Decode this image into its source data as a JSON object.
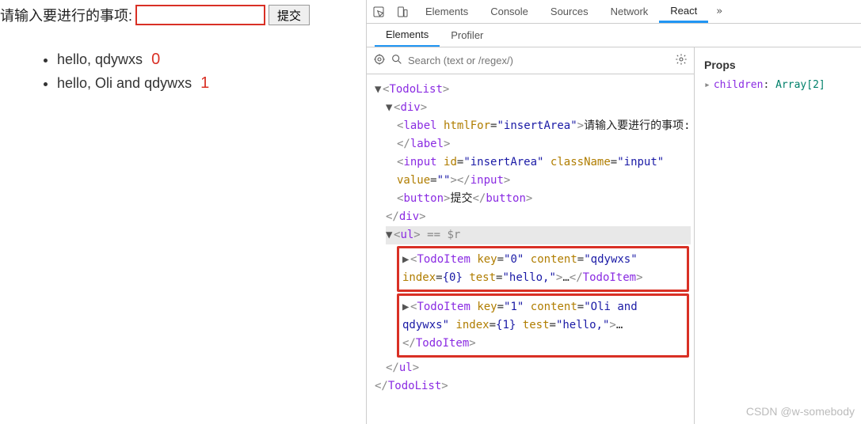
{
  "app": {
    "label": "请输入要进行的事项:",
    "inputValue": "",
    "submitLabel": "提交",
    "items": [
      {
        "text": "hello, qdywxs",
        "index": "0"
      },
      {
        "text": "hello, Oli and qdywxs",
        "index": "1"
      }
    ]
  },
  "devtools": {
    "tabs": [
      "Elements",
      "Console",
      "Sources",
      "Network",
      "React"
    ],
    "activeTab": "React",
    "more": "»",
    "subtabs": [
      "Elements",
      "Profiler"
    ],
    "activeSubtab": "Elements",
    "searchPlaceholder": "Search (text or /regex/)",
    "tree": {
      "root": "TodoList",
      "div": "div",
      "label_tag": "label",
      "label_htmlFor_attr": "htmlFor",
      "label_htmlFor_val": "\"insertArea\"",
      "label_text": "请输入要进行的事项:",
      "input_tag": "input",
      "input_id_attr": "id",
      "input_id_val": "\"insertArea\"",
      "input_cls_attr": "className",
      "input_cls_val": "\"input\"",
      "input_val_attr": "value",
      "input_val_val": "\"\"",
      "button_tag": "button",
      "button_text": "提交",
      "ul_sel": "== $r",
      "ti1_tag": "TodoItem",
      "ti1_key": "\"0\"",
      "ti1_content": "\"qdywxs\"",
      "ti1_index": "{0}",
      "ti1_test": "\"hello,\"",
      "ti2_tag": "TodoItem",
      "ti2_key": "\"1\"",
      "ti2_content": "\"Oli and qdywxs\"",
      "ti2_index": "{1}",
      "ti2_test": "\"hello,\""
    },
    "props": {
      "title": "Props",
      "key": "children",
      "val": "Array[2]"
    }
  },
  "watermark": "CSDN @w-somebody"
}
